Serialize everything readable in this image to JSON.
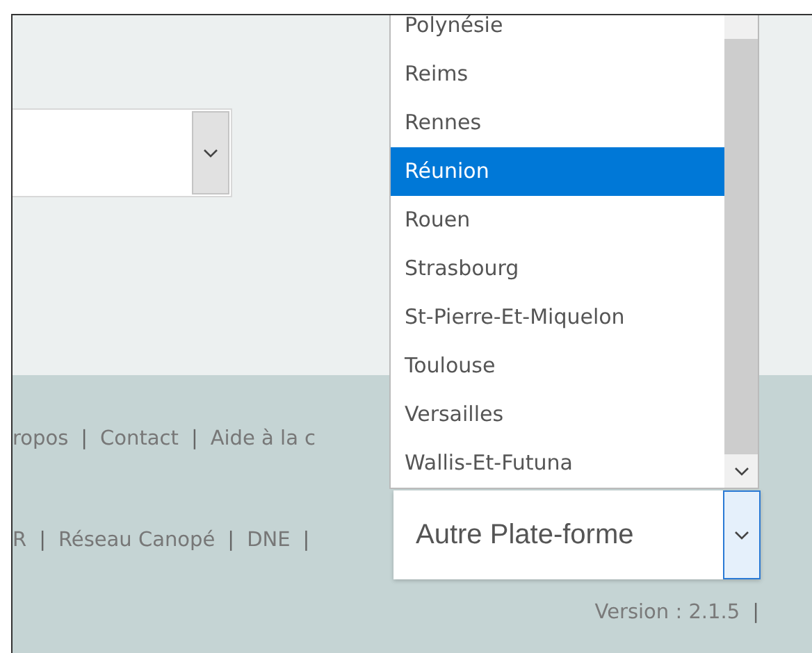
{
  "location_select": {
    "open": false
  },
  "dropdown": {
    "options": [
      {
        "label": "Polynésie",
        "selected": false
      },
      {
        "label": "Reims",
        "selected": false
      },
      {
        "label": "Rennes",
        "selected": false
      },
      {
        "label": "Réunion",
        "selected": true
      },
      {
        "label": "Rouen",
        "selected": false
      },
      {
        "label": "Strasbourg",
        "selected": false
      },
      {
        "label": "St-Pierre-Et-Miquelon",
        "selected": false
      },
      {
        "label": "Toulouse",
        "selected": false
      },
      {
        "label": "Versailles",
        "selected": false
      },
      {
        "label": "Wallis-Et-Futuna",
        "selected": false
      }
    ]
  },
  "footer": {
    "links_row_1": [
      {
        "kind": "link",
        "text": "ropos"
      },
      {
        "kind": "separator",
        "text": "|"
      },
      {
        "kind": "link",
        "text": "Contact"
      },
      {
        "kind": "separator",
        "text": "|"
      },
      {
        "kind": "link",
        "text": "Aide à la c"
      }
    ],
    "links_row_2": [
      {
        "kind": "link",
        "text": "R"
      },
      {
        "kind": "separator",
        "text": "|"
      },
      {
        "kind": "link",
        "text": "Réseau Canopé"
      },
      {
        "kind": "separator",
        "text": "|"
      },
      {
        "kind": "link",
        "text": "DNE"
      },
      {
        "kind": "separator",
        "text": "|"
      }
    ],
    "platform_select": {
      "value": "Autre Plate-forme"
    },
    "version_row": [
      {
        "kind": "text",
        "text": "Version : 2.1.5"
      },
      {
        "kind": "separator",
        "text": "|"
      }
    ]
  }
}
